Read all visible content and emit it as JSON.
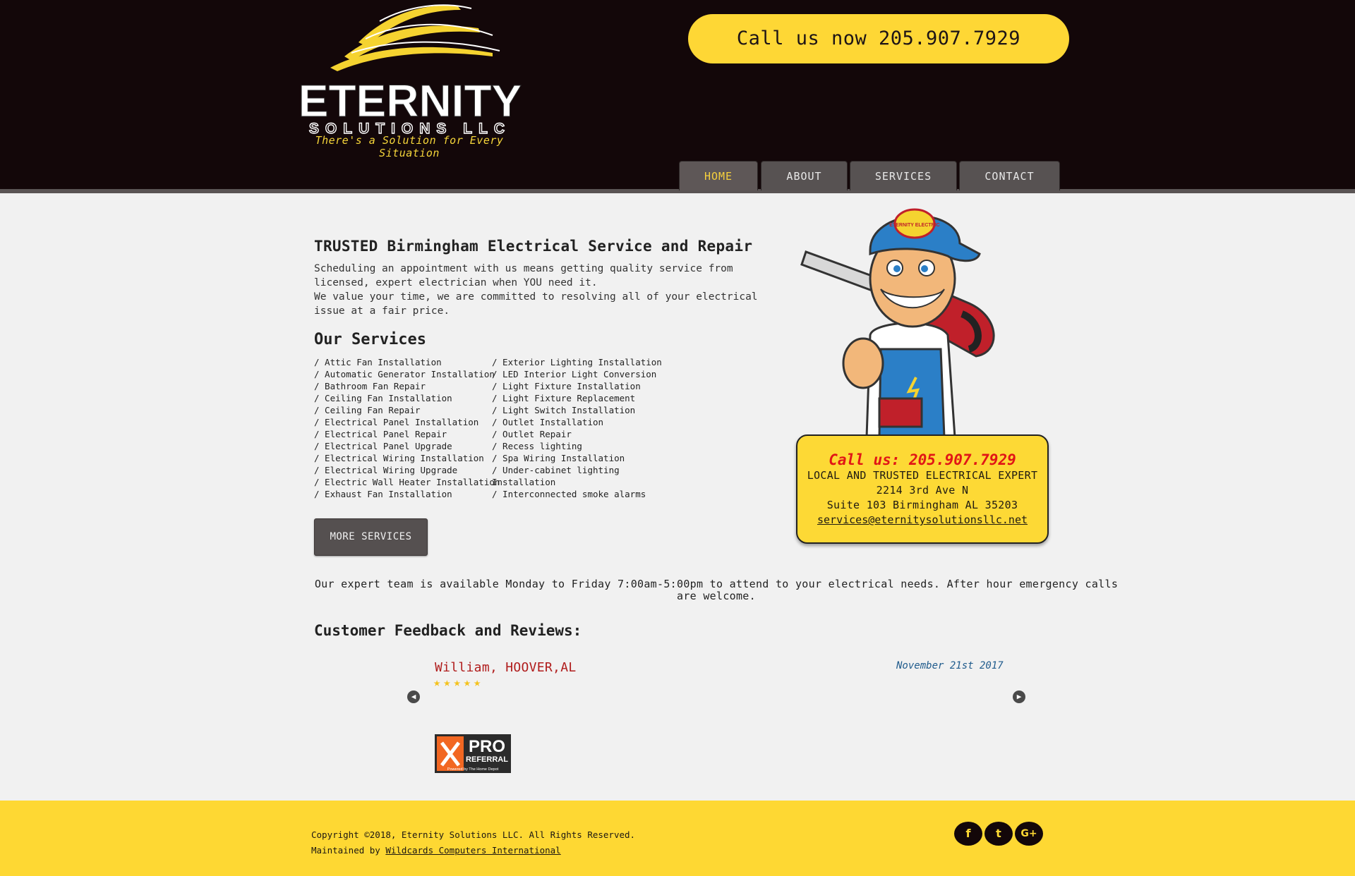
{
  "header": {
    "logo_line1": "ETERNITY",
    "logo_line2": "SOLUTIONS LLC",
    "tagline": "There's a Solution for Every Situation",
    "call_button": "Call us now 205.907.7929",
    "nav": [
      "HOME",
      "ABOUT",
      "SERVICES",
      "CONTACT"
    ],
    "nav_active": "HOME"
  },
  "main": {
    "headline": "TRUSTED Birmingham Electrical Service and Repair",
    "intro_1": "Scheduling an appointment with us means getting quality service from licensed, expert electrician when YOU need it.",
    "intro_2": "We value your time, we are committed to resolving all of your electrical issue at a fair price.",
    "services_title": "Our Services",
    "services_left": [
      "/ Attic Fan Installation",
      "/ Automatic Generator Installation",
      "/ Bathroom Fan Repair",
      "/ Ceiling Fan Installation",
      "/ Ceiling Fan Repair",
      "/ Electrical Panel Installation",
      "/ Electrical Panel Repair",
      "/ Electrical Panel Upgrade",
      "/ Electrical Wiring Installation",
      "/ Electrical Wiring Upgrade",
      "/ Electric Wall Heater Installation",
      "/ Exhaust Fan Installation"
    ],
    "services_right": [
      "/ Exterior Lighting Installation",
      "/ LED Interior Light Conversion",
      "/ Light Fixture Installation",
      "/ Light Fixture Replacement",
      "/ Light Switch Installation",
      "/ Outlet Installation",
      "/ Outlet Repair",
      "/ Recess lighting",
      "/ Spa Wiring Installation",
      "/ Under-cabinet lighting",
      "Installation",
      "/ Interconnected smoke alarms"
    ],
    "more_services": "MORE SERVICES",
    "hours": "Our expert team is available Monday to Friday 7:00am-5:00pm to attend to your electrical needs. After hour emergency calls are welcome.",
    "reviews_title": "Customer Feedback and Reviews:",
    "review": {
      "name": "William, HOOVER,AL",
      "stars": 5,
      "stars_text": "★★★★★",
      "date": "November 21st 2017"
    },
    "badge": {
      "line1": "PRO",
      "line2": "REFERRAL",
      "line3": "Powered by The Home Depot"
    }
  },
  "mascot": {
    "cap_text": "ETERNITY ELECTRIC"
  },
  "info_card": {
    "call": "Call us: 205.907.7929",
    "line1": "LOCAL AND TRUSTED ELECTRICAL EXPERT",
    "line2": "2214 3rd Ave N",
    "line3": "Suite 103 Birmingham AL 35203",
    "email": "services@eternitysolutionsllc.net"
  },
  "footer": {
    "copyright": "Copyright ©2018, Eternity Solutions LLC. All Rights Reserved.",
    "maintained_prefix": "Maintained by ",
    "maintained_link": "Wildcards Computers International",
    "social": [
      {
        "icon": "facebook-icon",
        "glyph": "f"
      },
      {
        "icon": "twitter-icon",
        "glyph": "t"
      },
      {
        "icon": "google-plus-icon",
        "glyph": "G+"
      }
    ]
  },
  "colors": {
    "header_bg": "#130709",
    "accent_yellow": "#fed735",
    "nav_tab": "#575252",
    "review_name": "#b01c1c",
    "call_red": "#e11616"
  }
}
